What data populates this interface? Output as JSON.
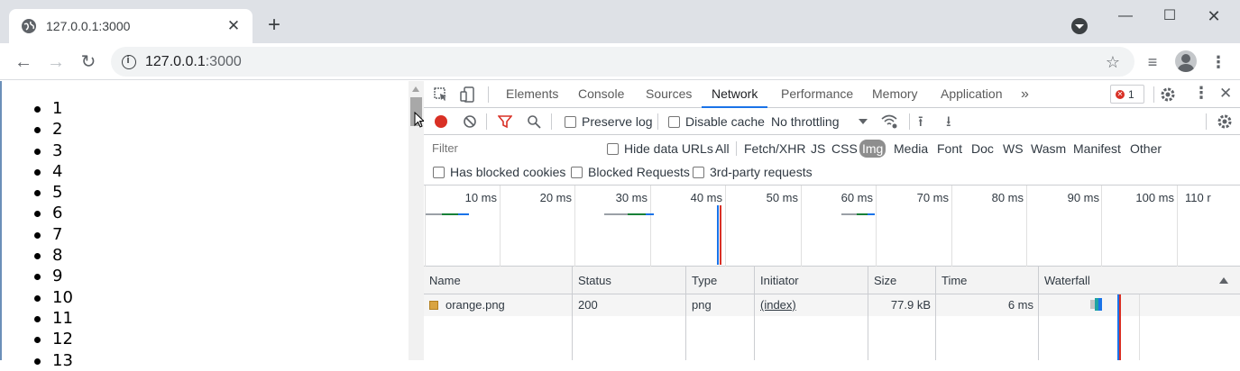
{
  "browser": {
    "tab_title": "127.0.0.1:3000",
    "url_host": "127.0.0.1",
    "url_port": ":3000"
  },
  "page": {
    "list_items": [
      "1",
      "2",
      "3",
      "4",
      "5",
      "6",
      "7",
      "8",
      "9",
      "10",
      "11",
      "12",
      "13"
    ]
  },
  "devtools": {
    "tabs": [
      "Elements",
      "Console",
      "Sources",
      "Network",
      "Performance",
      "Memory",
      "Application"
    ],
    "active_tab": "Network",
    "more_tabs": "»",
    "error_count": "1",
    "toolbar": {
      "preserve_log": "Preserve log",
      "disable_cache": "Disable cache",
      "throttling": "No throttling"
    },
    "filter": {
      "placeholder": "Filter",
      "hide_data_urls": "Hide data URLs",
      "types": [
        "All",
        "Fetch/XHR",
        "JS",
        "CSS",
        "Img",
        "Media",
        "Font",
        "Doc",
        "WS",
        "Wasm",
        "Manifest",
        "Other"
      ],
      "selected_type": "Img",
      "has_blocked_cookies": "Has blocked cookies",
      "blocked_requests": "Blocked Requests",
      "third_party": "3rd-party requests"
    },
    "timeline_ticks": [
      "10 ms",
      "20 ms",
      "30 ms",
      "40 ms",
      "50 ms",
      "60 ms",
      "70 ms",
      "80 ms",
      "90 ms",
      "100 ms",
      "110 r"
    ],
    "table": {
      "columns": [
        "Name",
        "Status",
        "Type",
        "Initiator",
        "Size",
        "Time",
        "Waterfall"
      ],
      "rows": [
        {
          "name": "orange.png",
          "status": "200",
          "type": "png",
          "initiator": "(index)",
          "size": "77.9 kB",
          "time": "6 ms"
        }
      ]
    },
    "colors": {
      "accent": "#1a73e8",
      "record": "#d93025",
      "dcl_line": "#1a73e8",
      "load_line": "#d93025"
    }
  }
}
